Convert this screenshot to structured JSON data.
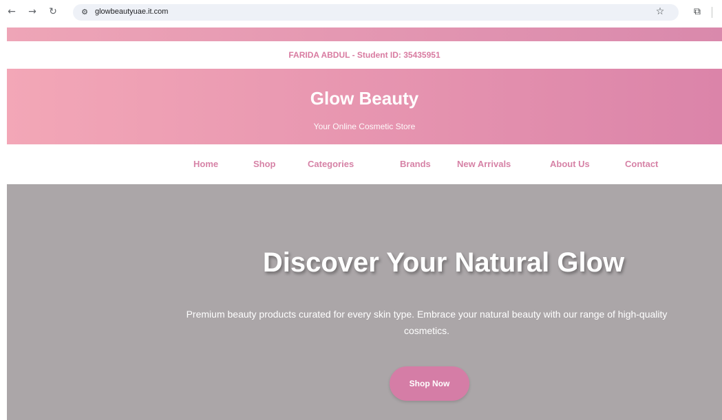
{
  "browser": {
    "url": "glowbeautyuae.it.com",
    "icons": {
      "back": "arrow-left-icon",
      "forward": "arrow-right-icon",
      "reload": "reload-icon",
      "site_info": "tune-icon",
      "bookmark": "star-icon",
      "extensions": "puzzle-icon"
    }
  },
  "student": {
    "text": "FARIDA ABDUL - Student ID: 35435951"
  },
  "header": {
    "brand": "Glow Beauty",
    "tagline": "Your Online Cosmetic Store"
  },
  "nav": {
    "items": [
      {
        "label": "Home"
      },
      {
        "label": "Shop"
      },
      {
        "label": "Categories"
      },
      {
        "label": "Brands"
      },
      {
        "label": "New Arrivals"
      },
      {
        "label": "About Us"
      },
      {
        "label": "Contact"
      }
    ]
  },
  "hero": {
    "title": "Discover Your Natural Glow",
    "text": "Premium beauty products curated for every skin type. Embrace your natural beauty with our range of high-quality cosmetics.",
    "button": "Shop Now"
  },
  "colors": {
    "accent_pink": "#d682a6",
    "header_gradient_start": "#f3a7b7",
    "header_gradient_end": "#db84a9",
    "hero_background": "#aba6a8",
    "button": "#d57da6"
  }
}
